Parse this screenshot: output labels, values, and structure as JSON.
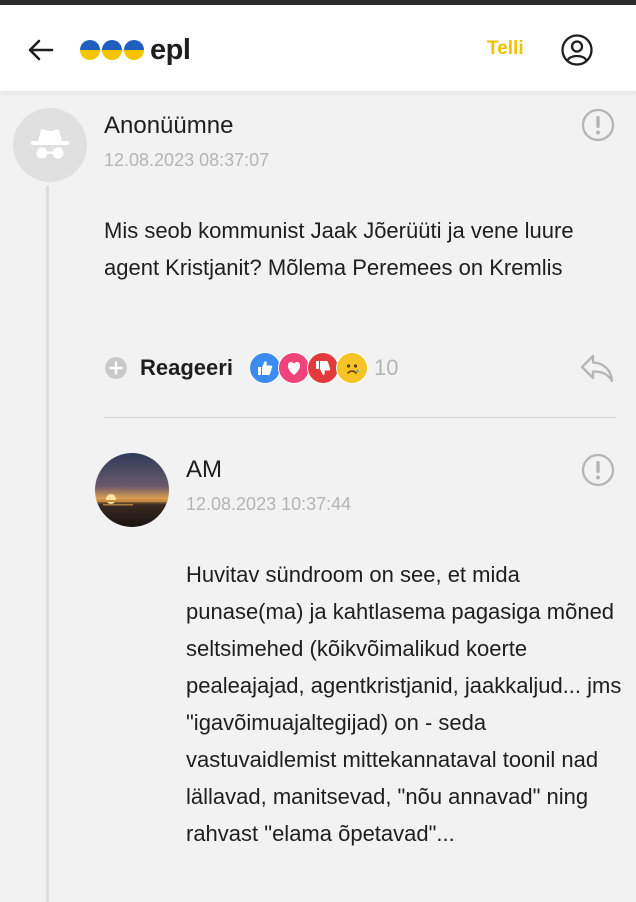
{
  "header": {
    "logo_text": "epl",
    "subscribe_label": "Telli",
    "colors": {
      "subscribe": "#f2c200",
      "flag_blue": "#1f5fbf",
      "flag_yellow": "#f5c400"
    }
  },
  "comments": [
    {
      "author": "Anonüümne",
      "timestamp": "12.08.2023 08:37:07",
      "text": "Mis seob kommunist Jaak Jõerüüti ja vene luure agent Kristjanit? Mõlema Peremees on Kremlis",
      "react_label": "Reageeri",
      "reaction_icons": [
        "thumbs-up-icon",
        "heart-icon",
        "thumbs-down-icon",
        "sad-face-icon"
      ],
      "reaction_count": "10"
    },
    {
      "author": "AM",
      "timestamp": "12.08.2023 10:37:44",
      "text": "Huvitav sündroom on see, et mida punase(ma) ja kahtlasema pagasiga mõned seltsimehed (kõikvõimalikud koerte pealeajajad, agentkristjanid, jaakkaljud... jms \"igavõimuajaltegijad) on - seda vastuvaidlemist mittekannataval toonil nad lällavad, manitsevad, \"nõu annavad\" ning rahvast \"elama õpetavad\"..."
    }
  ]
}
